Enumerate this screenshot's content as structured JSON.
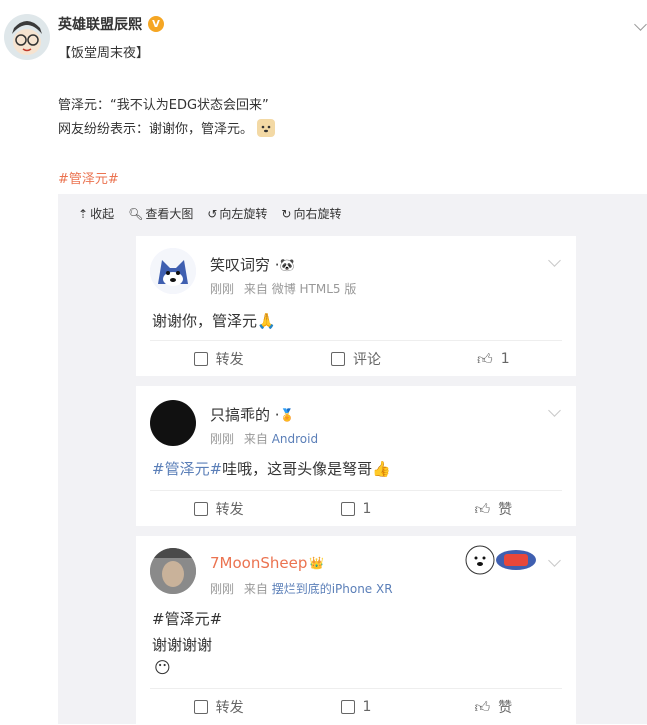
{
  "post": {
    "author": "英雄联盟辰熙",
    "verified_badge": "V",
    "line1": "【饭堂周末夜】",
    "line2": "管泽元：“我不认为EDG状态会回来”",
    "line3": "网友纷纷表示：谢谢你，管泽元。",
    "hashtag": "#管泽元#"
  },
  "toolbar": {
    "collapse": "收起",
    "view_large": "查看大图",
    "rotate_left": "向左旋转",
    "rotate_right": "向右旋转"
  },
  "comments": [
    {
      "user": "笑叹词穷 · ",
      "time": "刚刚",
      "source_prefix": "来自",
      "source": "微博 HTML5 版",
      "text": "谢谢你，管泽元",
      "repost": "转发",
      "comment": "评论",
      "like": "1"
    },
    {
      "user": "只搞乖的 · ",
      "time": "刚刚",
      "source_prefix": "来自",
      "source": "Android",
      "hashtag": "#管泽元#",
      "text": " 哇哦，这哥头像是弩哥",
      "repost": "转发",
      "comment": "1",
      "like": "赞"
    },
    {
      "user": "7MoonSheep",
      "time": "刚刚",
      "source_prefix": "来自",
      "source": "摆烂到底的iPhone XR",
      "hashtag": "#管泽元#",
      "text": "谢谢谢谢",
      "repost": "转发",
      "comment": "1",
      "like": "赞"
    }
  ],
  "colors": {
    "link": "#eb7350",
    "blue_link": "#5b7fb8",
    "gray_bg": "#f2f2f5"
  }
}
